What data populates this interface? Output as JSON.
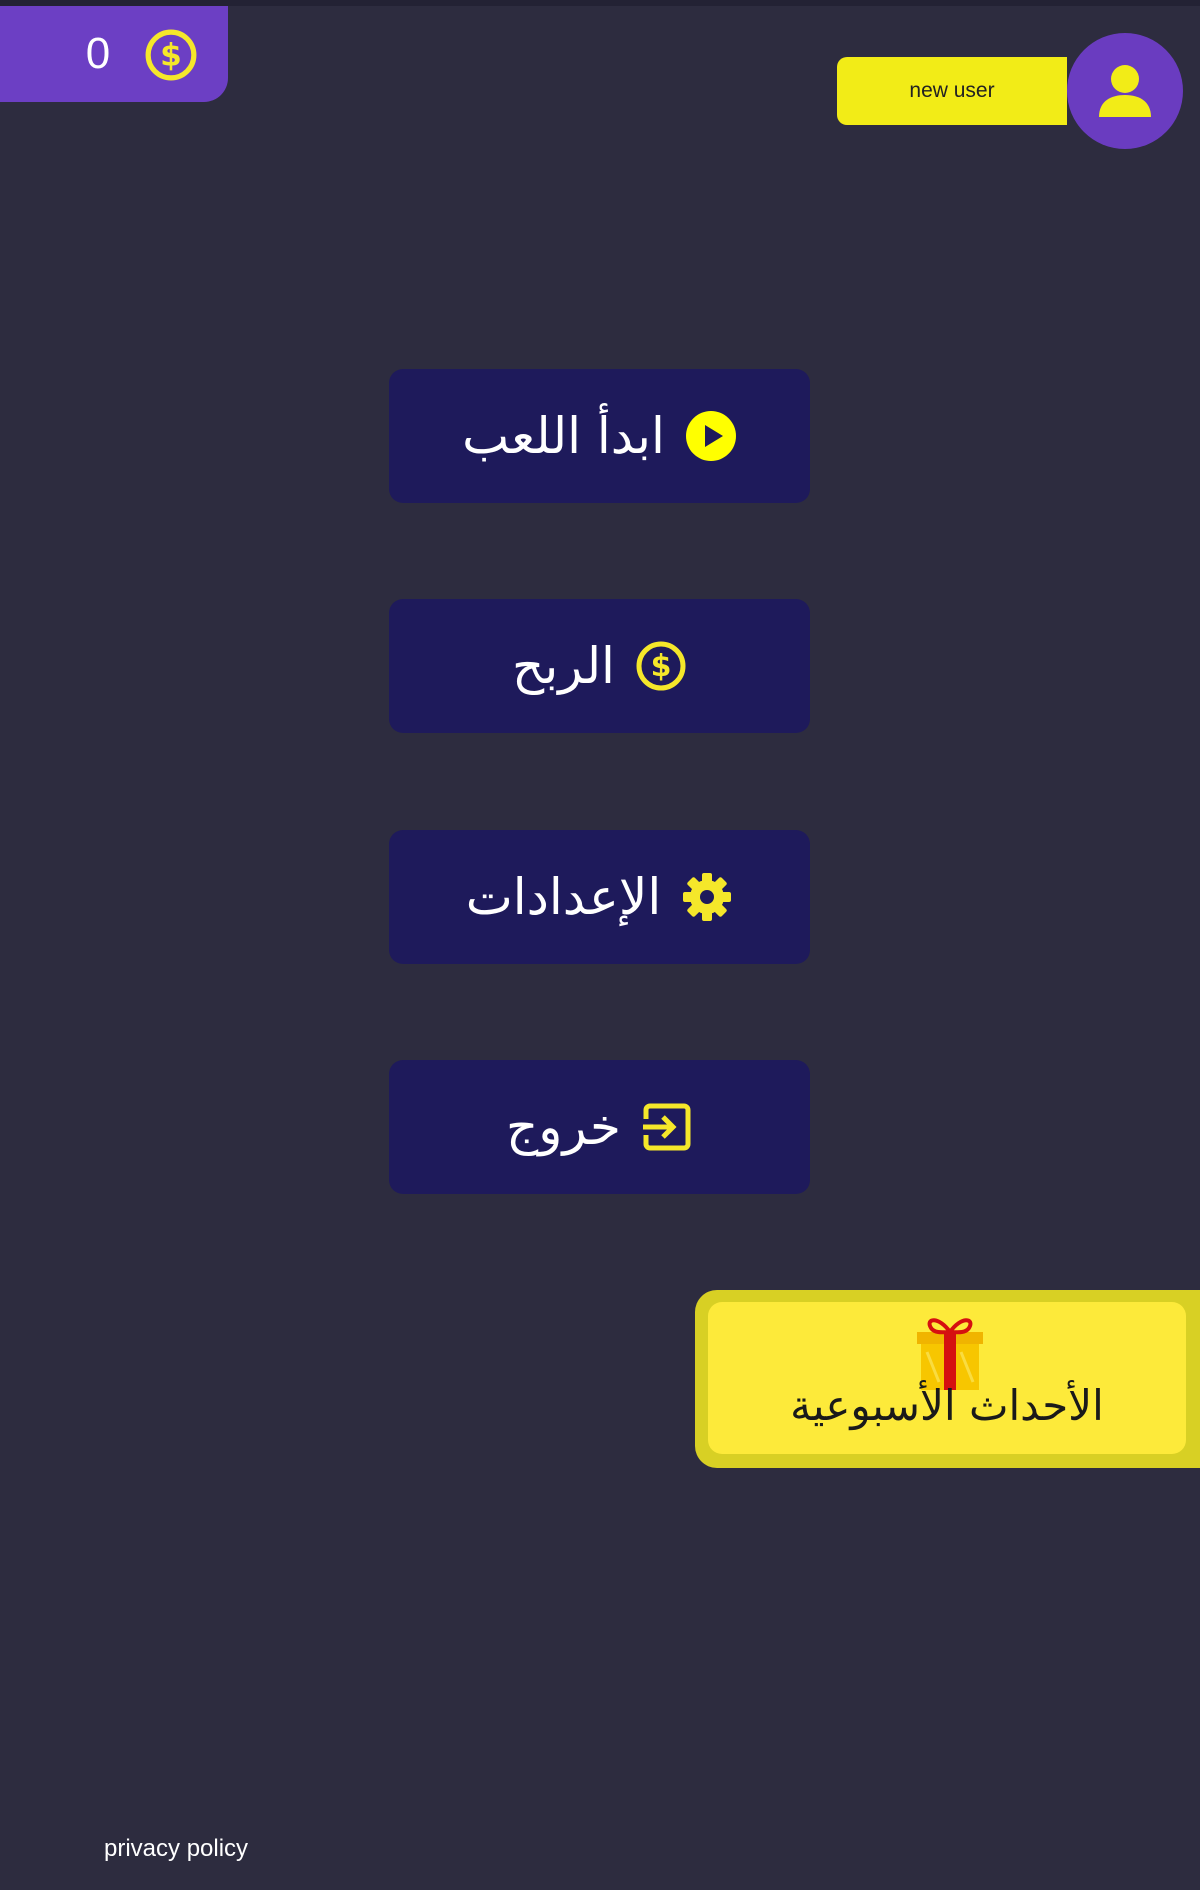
{
  "header": {
    "coin_count": "0",
    "coin_icon": "dollar-coin-icon",
    "username": "new user",
    "avatar_icon": "user-icon"
  },
  "menu": {
    "items": [
      {
        "label": "ابدأ اللعب",
        "icon": "play-circle-icon"
      },
      {
        "label": "الربح",
        "icon": "dollar-coin-icon"
      },
      {
        "label": "الإعدادات",
        "icon": "gear-icon"
      },
      {
        "label": "خروج",
        "icon": "exit-icon"
      }
    ]
  },
  "events": {
    "label": "الأحداث الأسبوعية",
    "icon": "gift-icon"
  },
  "footer": {
    "privacy_label": "privacy policy"
  },
  "colors": {
    "background": "#2d2c3f",
    "coin_panel": "#6c3fc4",
    "accent_yellow": "#f2ec17",
    "button_bg": "#1e1a5b",
    "events_bg": "#fdea3a"
  }
}
